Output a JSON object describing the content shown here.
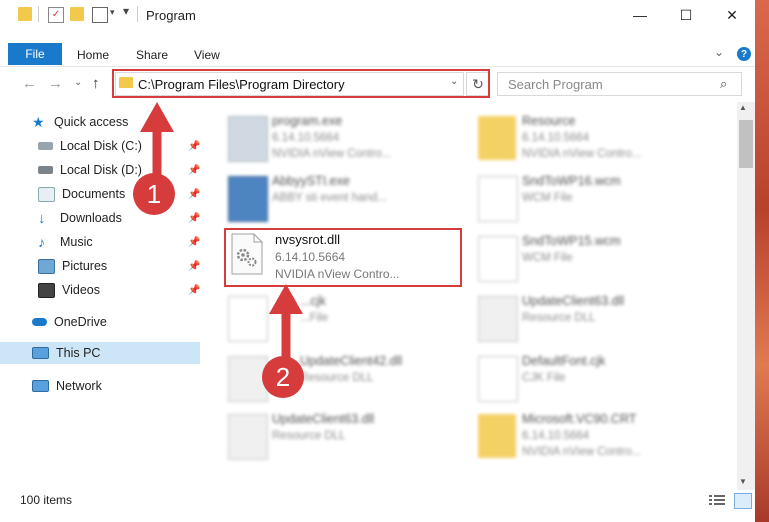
{
  "window": {
    "title": "Program",
    "minimize": "—",
    "maximize": "☐",
    "close": "✕"
  },
  "ribbon": {
    "tabs": [
      "File",
      "Home",
      "Share",
      "View"
    ],
    "help": "?",
    "expand": "⌄"
  },
  "nav": {
    "back": "←",
    "forward": "→",
    "recent": "⌄",
    "up": "↑",
    "address": "C:\\Program Files\\Program Directory",
    "address_dropdown": "⌄",
    "refresh": "↻",
    "search_placeholder": "Search Program",
    "search_icon": "⌕"
  },
  "sidebar": {
    "items": [
      {
        "label": "Quick access",
        "icon": "star-icon"
      },
      {
        "label": "Local Disk (C:)",
        "icon": "drive-icon",
        "pinned": true
      },
      {
        "label": "Local Disk (D:)",
        "icon": "drive-icon",
        "pinned": true
      },
      {
        "label": "Documents",
        "icon": "documents-icon",
        "pinned": true
      },
      {
        "label": "Downloads",
        "icon": "downloads-icon",
        "pinned": true
      },
      {
        "label": "Music",
        "icon": "music-icon",
        "pinned": true
      },
      {
        "label": "Pictures",
        "icon": "pictures-icon",
        "pinned": true
      },
      {
        "label": "Videos",
        "icon": "videos-icon",
        "pinned": true
      },
      {
        "label": "OneDrive",
        "icon": "cloud-icon"
      },
      {
        "label": "This PC",
        "icon": "computer-icon",
        "selected": true
      },
      {
        "label": "Network",
        "icon": "network-icon"
      }
    ],
    "pin_glyph": "📌"
  },
  "files": [
    {
      "name": "program.exe",
      "line2": "6.14.10.5664",
      "line3": "NVIDIA nView Contro..."
    },
    {
      "name": "Resource",
      "line2": "6.14.10.5664",
      "line3": "NVIDIA nView Contro..."
    },
    {
      "name": "AbbyySTI.exe",
      "line2": "ABBY sti event hand...",
      "line3": ""
    },
    {
      "name": "SndToWP16.wcm",
      "line2": "WCM File",
      "line3": ""
    },
    {
      "name": "nvsysrot.dll",
      "line2": "6.14.10.5664",
      "line3": "NVIDIA nView Contro..."
    },
    {
      "name": "SndToWP15.wcm",
      "line2": "WCM File",
      "line3": ""
    },
    {
      "name": "...cjk",
      "line2": "...File",
      "line3": ""
    },
    {
      "name": "UpdateClient63.dll",
      "line2": "Resource DLL",
      "line3": ""
    },
    {
      "name": "UpdateClient42.dll",
      "line2": "Resource DLL",
      "line3": ""
    },
    {
      "name": "DefaultFont.cjk",
      "line2": "CJK File",
      "line3": ""
    },
    {
      "name": "UpdateClient63.dll",
      "line2": "Resource DLL",
      "line3": ""
    },
    {
      "name": "Microsoft.VC90.CRT",
      "line2": "6.14.10.5664",
      "line3": "NVIDIA nView Contro..."
    }
  ],
  "status": {
    "count": "100 items"
  },
  "callouts": [
    "1",
    "2"
  ],
  "colors": {
    "accent": "#1979ca",
    "highlight": "#d63c3c",
    "folder": "#f3c94b"
  }
}
